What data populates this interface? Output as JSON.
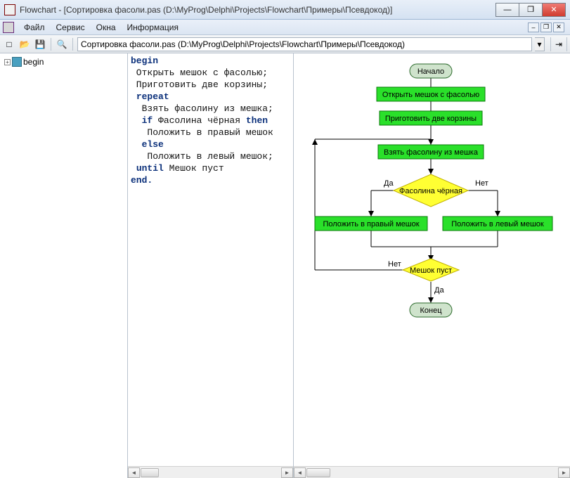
{
  "window": {
    "title": "Flowchart - [Сортировка фасоли.pas (D:\\MyProg\\Delphi\\Projects\\Flowchart\\Примеры\\Псевдокод)]",
    "min_glyph": "—",
    "max_glyph": "❐",
    "close_glyph": "✕"
  },
  "menu": {
    "items": [
      "Файл",
      "Сервис",
      "Окна",
      "Информация"
    ],
    "mdi_min": "–",
    "mdi_restore": "❐",
    "mdi_close": "✕"
  },
  "toolbar": {
    "new_icon": "□",
    "open_icon": "📂",
    "save_icon": "💾",
    "find_icon": "🔍",
    "path": "Сортировка фасоли.pas (D:\\MyProg\\Delphi\\Projects\\Flowchart\\Примеры\\Псевдокод)",
    "dd_glyph": "▾",
    "right_glyph": "⇥"
  },
  "tree": {
    "plus": "+",
    "root": "begin"
  },
  "code": {
    "lines": [
      {
        "kw": [
          "begin"
        ]
      },
      {
        "lead": " ",
        "text": "Открыть мешок с фасолью;"
      },
      {
        "lead": " ",
        "text": "Приготовить две корзины;"
      },
      {
        "lead": " ",
        "kw": [
          "repeat"
        ]
      },
      {
        "lead": "  ",
        "text": "Взять фасолину из мешка;"
      },
      {
        "lead": "  ",
        "kw": [
          "if"
        ],
        "text": " Фасолина чёрная ",
        "kw2": [
          "then"
        ]
      },
      {
        "lead": "   ",
        "text": "Положить в правый мешок"
      },
      {
        "lead": "  ",
        "kw": [
          "else"
        ]
      },
      {
        "lead": "   ",
        "text": "Положить в левый мешок;"
      },
      {
        "lead": " ",
        "kw": [
          "until"
        ],
        "text": " Мешок пуст"
      },
      {
        "kw": [
          "end."
        ]
      }
    ]
  },
  "flow": {
    "start": "Начало",
    "open": "Открыть мешок с фасолью",
    "prep": "Приготовить две корзины",
    "take": "Взять фасолину из мешка",
    "cond1": "Фасолина чёрная",
    "yes": "Да",
    "no": "Нет",
    "right": "Положить в правый мешок",
    "left": "Положить в левый мешок",
    "cond2": "Мешок пуст",
    "end": "Конец",
    "net": "Нет"
  },
  "sb": {
    "left": "◄",
    "right": "►"
  }
}
